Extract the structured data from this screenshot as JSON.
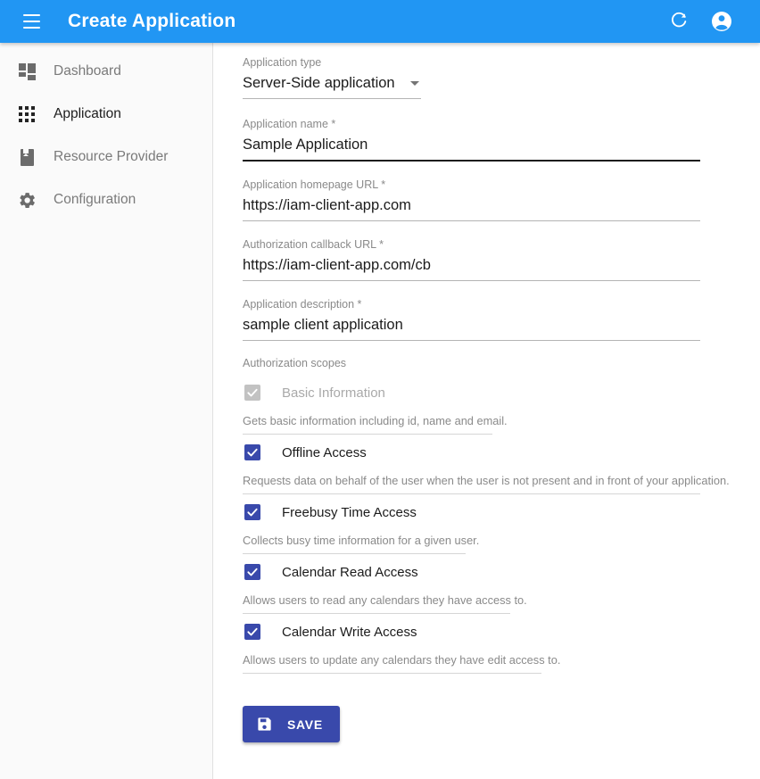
{
  "appbar": {
    "title": "Create Application",
    "menu_icon": "hamburger-menu-icon",
    "refresh_icon": "refresh-icon",
    "account_icon": "account-circle-icon",
    "background_color": "#2196f3"
  },
  "sidebar": {
    "items": [
      {
        "label": "Dashboard",
        "icon": "dashboard-icon",
        "active": false
      },
      {
        "label": "Application",
        "icon": "apps-grid-icon",
        "active": true
      },
      {
        "label": "Resource Provider",
        "icon": "book-icon",
        "active": false
      },
      {
        "label": "Configuration",
        "icon": "gear-icon",
        "active": false
      }
    ]
  },
  "form": {
    "app_type": {
      "label": "Application type",
      "value": "Server-Side application",
      "options": [
        "Server-Side application"
      ]
    },
    "app_name": {
      "label": "Application name *",
      "value": "Sample Application",
      "focused": true
    },
    "homepage_url": {
      "label": "Application homepage URL *",
      "value": "https://iam-client-app.com"
    },
    "callback_url": {
      "label": "Authorization callback URL *",
      "value": "https://iam-client-app.com/cb"
    },
    "description": {
      "label": "Application description *",
      "value": "sample client application"
    },
    "scopes_label": "Authorization scopes",
    "scopes": [
      {
        "name": "Basic Information",
        "description": "Gets basic information including id, name and email.",
        "checked": true,
        "disabled": true
      },
      {
        "name": "Offline Access",
        "description": "Requests data on behalf of the user when the user is not present and in front of your application.",
        "checked": true,
        "disabled": false
      },
      {
        "name": "Freebusy Time Access",
        "description": "Collects busy time information for a given user.",
        "checked": true,
        "disabled": false
      },
      {
        "name": "Calendar Read Access",
        "description": "Allows users to read any calendars they have access to.",
        "checked": true,
        "disabled": false
      },
      {
        "name": "Calendar Write Access",
        "description": "Allows users to update any calendars they have edit access to.",
        "checked": true,
        "disabled": false
      }
    ],
    "save_button": {
      "label": "SAVE",
      "icon": "save-floppy-icon",
      "color": "#3949ab"
    }
  }
}
